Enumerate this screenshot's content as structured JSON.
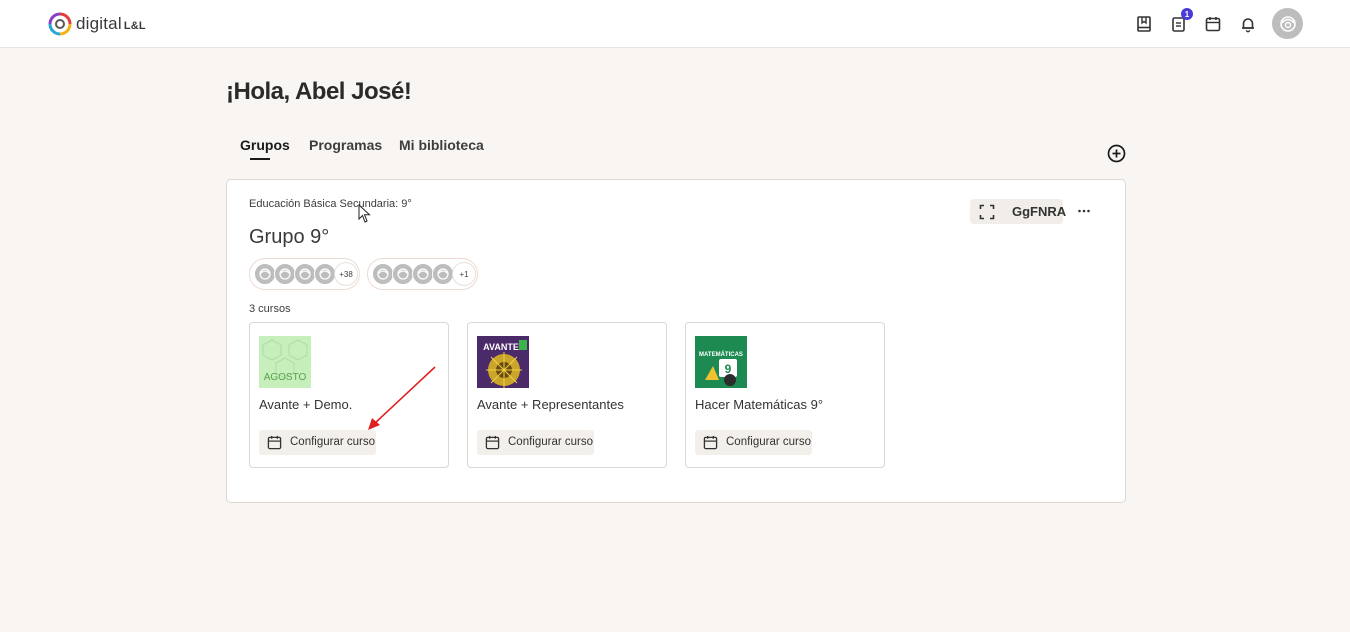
{
  "header": {
    "logo_text": "digital",
    "logo_suffix": "L&L",
    "icons": [
      "book-icon",
      "tasks-icon",
      "calendar-icon",
      "bell-icon",
      "user-avatar"
    ],
    "tasks_badge": "1"
  },
  "greeting": "¡Hola, Abel José!",
  "tabs": [
    {
      "label": "Grupos",
      "active": true
    },
    {
      "label": "Programas",
      "active": false
    },
    {
      "label": "Mi biblioteca",
      "active": false
    }
  ],
  "group": {
    "subtitle": "Educación Básica Secundaria: 9°",
    "title": "Grupo 9°",
    "code": "GgFNRA",
    "students_more": "+38",
    "teachers_more": "+1",
    "course_count": "3 cursos",
    "courses": [
      {
        "name": "Avante + Demo.",
        "button": "Configurar curso",
        "cover_text": "AGOSTO"
      },
      {
        "name": "Avante + Representantes",
        "button": "Configurar curso",
        "cover_text": "AVANTE"
      },
      {
        "name": "Hacer Matemáticas 9°",
        "button": "Configurar curso",
        "cover_text": "MATEMÁTICAS"
      }
    ]
  },
  "colors": {
    "background": "#f8f5f2",
    "badge": "#4a3ad6",
    "annotation_arrow": "#e02020"
  }
}
